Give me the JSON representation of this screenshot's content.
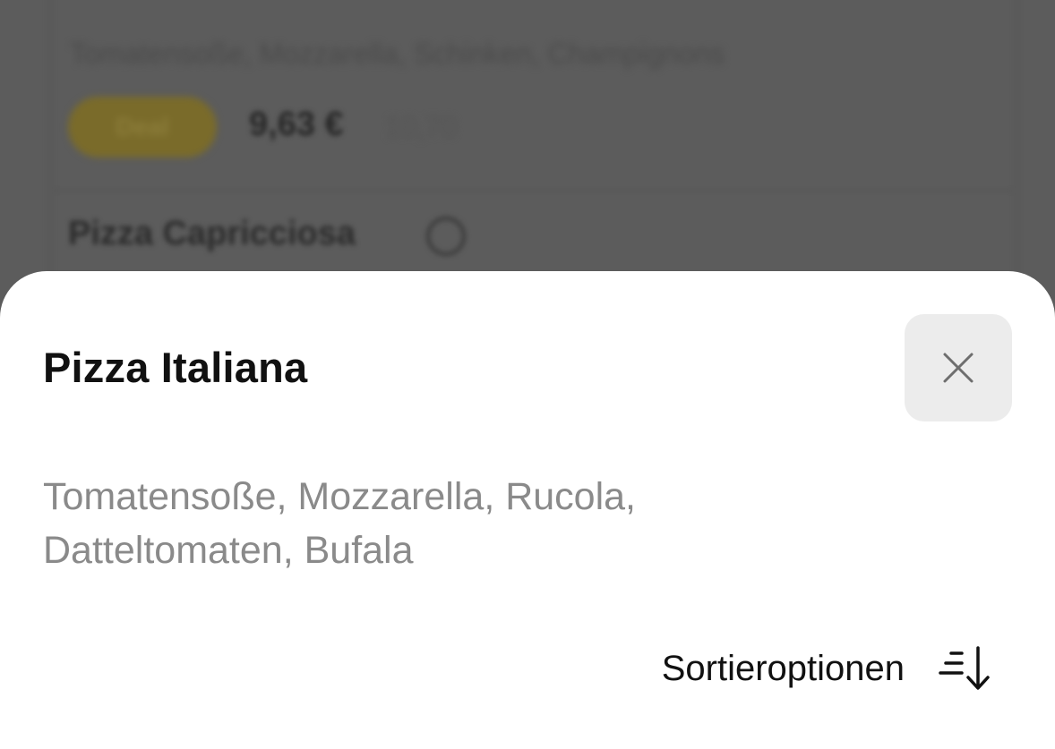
{
  "background": {
    "top_text": "",
    "ingredients": "Tomatensoße, Mozzarella, Schinken, Champignons",
    "badge_label": "Deal",
    "price": "9,63 €",
    "old_price": "10,70",
    "next_item_title": "Pizza Capricciosa"
  },
  "sheet": {
    "title": "Pizza Italiana",
    "description": "Tomatensoße, Mozzarella, Rucola, Datteltomaten, Bufala",
    "close_icon": "close-icon",
    "sort_label": "Sortieroptionen",
    "sort_icon": "sort-descending-icon"
  },
  "colors": {
    "overlay": "#5c5c5c",
    "sheet_bg": "#ffffff",
    "close_bg": "#ececec",
    "description": "#8a8a8a"
  }
}
